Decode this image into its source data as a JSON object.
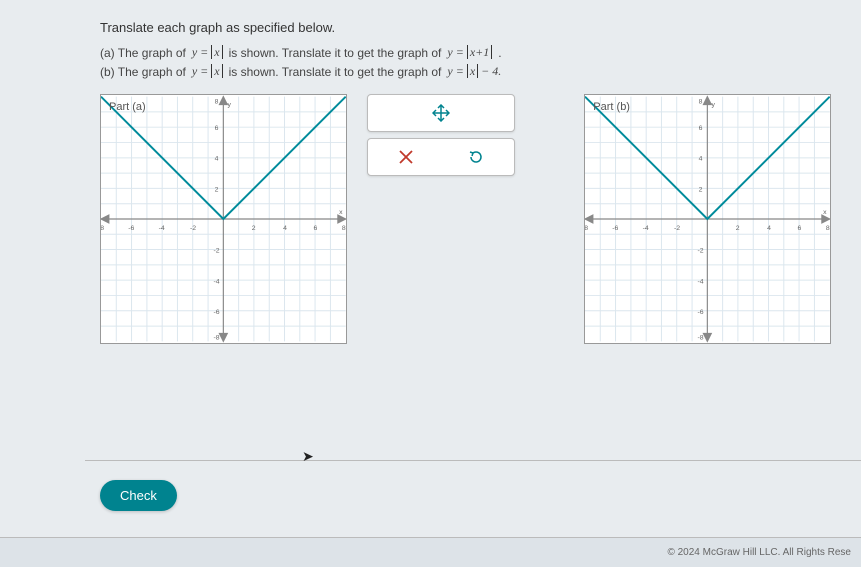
{
  "instruction": "Translate each graph as specified below.",
  "part_a_prefix": "(a) The graph of ",
  "part_a_mid": " is shown. Translate it to get the graph of ",
  "part_a_eq1": "y = |x|",
  "part_a_eq2": "y = |x+1|",
  "part_a_end": " .",
  "part_b_prefix": "(b) The graph of ",
  "part_b_mid": " is shown. Translate it to get the graph of ",
  "part_b_eq1": "y = |x|",
  "part_b_eq2": "y = |x| − 4.",
  "graph_a_label": "Part (a)",
  "graph_b_label": "Part (b)",
  "tool_move": "✥",
  "tool_close": "✕",
  "tool_reset": "↺",
  "check_label": "Check",
  "copyright": "© 2024 McGraw Hill LLC. All Rights Rese",
  "chart_data": [
    {
      "type": "line",
      "title": "Part (a): y = |x|",
      "xlabel": "x",
      "ylabel": "y",
      "xlim": [
        -8,
        8
      ],
      "ylim": [
        -8,
        8
      ],
      "series": [
        {
          "name": "y=|x|",
          "x": [
            -8,
            -6,
            -4,
            -2,
            0,
            2,
            4,
            6,
            8
          ],
          "values": [
            8,
            6,
            4,
            2,
            0,
            2,
            4,
            6,
            8
          ]
        }
      ]
    },
    {
      "type": "line",
      "title": "Part (b): y = |x|",
      "xlabel": "x",
      "ylabel": "y",
      "xlim": [
        -8,
        8
      ],
      "ylim": [
        -8,
        8
      ],
      "series": [
        {
          "name": "y=|x|",
          "x": [
            -8,
            -6,
            -4,
            -2,
            0,
            2,
            4,
            6,
            8
          ],
          "values": [
            8,
            6,
            4,
            2,
            0,
            2,
            4,
            6,
            8
          ]
        }
      ]
    }
  ]
}
